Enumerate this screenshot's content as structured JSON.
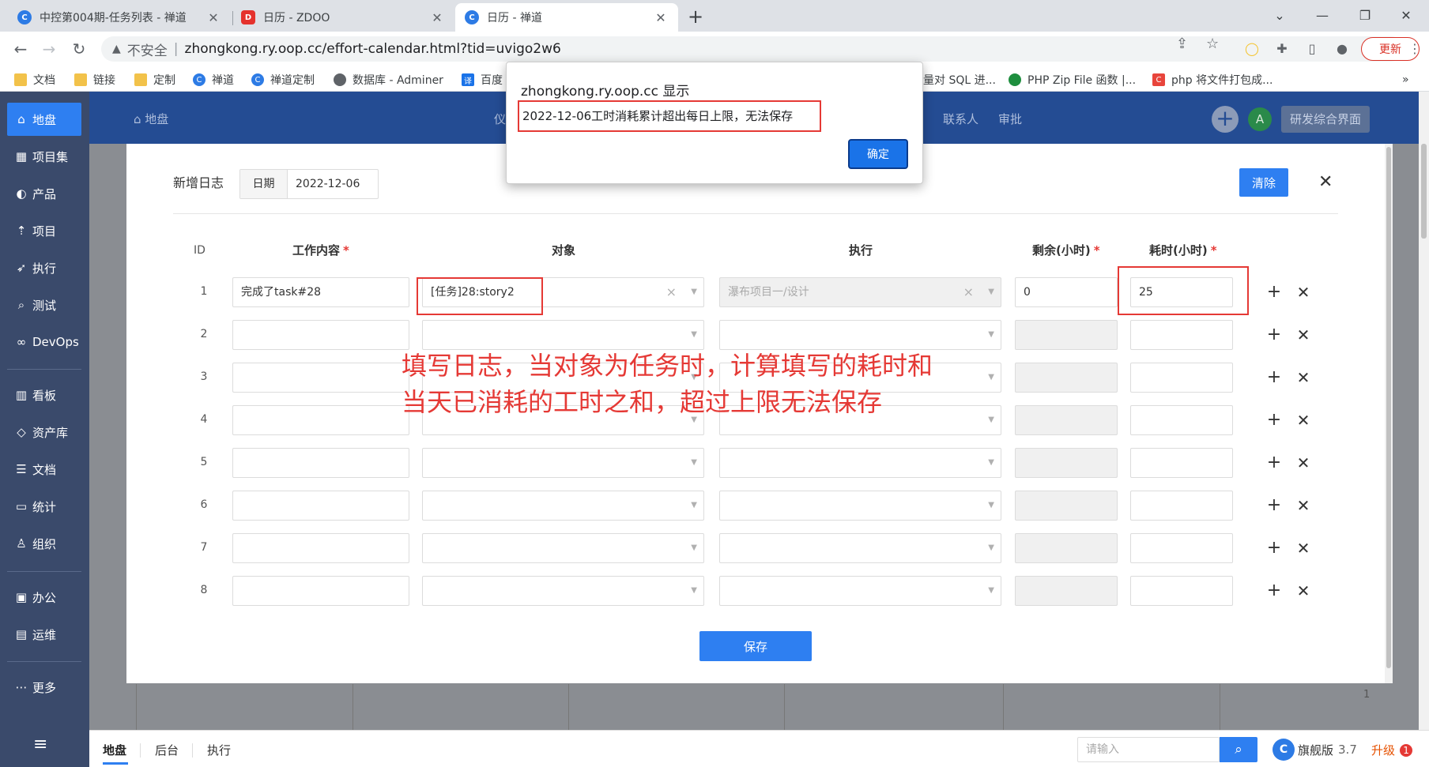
{
  "browser": {
    "tabs": [
      {
        "title": "中控第004期-任务列表 - 禅道",
        "icon": "chandao-icon",
        "active": false
      },
      {
        "title": "日历 - ZDOO",
        "icon": "zdoo-icon",
        "active": false
      },
      {
        "title": "日历 - 禅道",
        "icon": "chandao-icon",
        "active": true
      }
    ],
    "new_tab": "+",
    "insecure_label": "不安全",
    "url": "zhongkong.ry.oop.cc/effort-calendar.html?tid=uvigo2w6",
    "update_label": "更新",
    "bookmarks": [
      {
        "label": "文档",
        "icon": "folder-icon"
      },
      {
        "label": "链接",
        "icon": "folder-icon"
      },
      {
        "label": "定制",
        "icon": "folder-icon"
      },
      {
        "label": "禅道",
        "icon": "chandao-icon"
      },
      {
        "label": "禅道定制",
        "icon": "chandao-icon"
      },
      {
        "label": "数据库 - Adminer",
        "icon": "globe-icon"
      },
      {
        "label": "百度",
        "icon": "translate-icon"
      },
      {
        "label": "量对 SQL 进...",
        "icon": "none"
      },
      {
        "label": "PHP Zip File 函数 |...",
        "icon": "zip-icon"
      },
      {
        "label": "php 将文件打包成...",
        "icon": "php-icon"
      }
    ],
    "bookmarks_more": "»"
  },
  "sidebar": {
    "items": [
      {
        "label": "地盘",
        "icon": "home-icon",
        "glyph": "⌂"
      },
      {
        "label": "项目集",
        "icon": "grid-icon",
        "glyph": "▦"
      },
      {
        "label": "产品",
        "icon": "bulb-icon",
        "glyph": "◐"
      },
      {
        "label": "项目",
        "icon": "rocket-icon",
        "glyph": "⇡"
      },
      {
        "label": "执行",
        "icon": "run-icon",
        "glyph": "➶"
      },
      {
        "label": "测试",
        "icon": "search-icon",
        "glyph": "⌕"
      },
      {
        "label": "DevOps",
        "icon": "infinity-icon",
        "glyph": "∞"
      },
      {
        "label": "看板",
        "icon": "kanban-icon",
        "glyph": "▥"
      },
      {
        "label": "资产库",
        "icon": "diamond-icon",
        "glyph": "◇"
      },
      {
        "label": "文档",
        "icon": "doc-icon",
        "glyph": "☰"
      },
      {
        "label": "统计",
        "icon": "chart-icon",
        "glyph": "▭"
      },
      {
        "label": "组织",
        "icon": "people-icon",
        "glyph": "♙"
      },
      {
        "label": "办公",
        "icon": "office-icon",
        "glyph": "▣"
      },
      {
        "label": "运维",
        "icon": "ops-icon",
        "glyph": "▤"
      },
      {
        "label": "更多",
        "icon": "more-icon",
        "glyph": "⋯"
      }
    ],
    "toggle_glyph": "≡"
  },
  "topnav": {
    "crumb": "地盘",
    "menu_partial": "仪",
    "menu": [
      "联系人",
      "审批"
    ],
    "avatar": "A",
    "switch_label": "研发综合界面"
  },
  "calendar_bg": {
    "day_number": "1"
  },
  "modal": {
    "title": "新增日志",
    "date_label": "日期",
    "date_value": "2022-12-06",
    "clear_label": "清除",
    "close_glyph": "✕",
    "headers": {
      "id": "ID",
      "content": "工作内容",
      "object": "对象",
      "execution": "执行",
      "left": "剩余(小时)",
      "consumed": "耗时(小时)",
      "required_mark": "*"
    },
    "rows": [
      {
        "id": "1",
        "content": "完成了task#28",
        "object": "[任务]28:story2",
        "execution": "瀑布项目一/设计",
        "left": "0",
        "consumed": "25"
      },
      {
        "id": "2",
        "content": "",
        "object": "",
        "execution": "",
        "left": "",
        "consumed": ""
      },
      {
        "id": "3",
        "content": "",
        "object": "",
        "execution": "",
        "left": "",
        "consumed": ""
      },
      {
        "id": "4",
        "content": "",
        "object": "",
        "execution": "",
        "left": "",
        "consumed": ""
      },
      {
        "id": "5",
        "content": "",
        "object": "",
        "execution": "",
        "left": "",
        "consumed": ""
      },
      {
        "id": "6",
        "content": "",
        "object": "",
        "execution": "",
        "left": "",
        "consumed": ""
      },
      {
        "id": "7",
        "content": "",
        "object": "",
        "execution": "",
        "left": "",
        "consumed": ""
      },
      {
        "id": "8",
        "content": "",
        "object": "",
        "execution": "",
        "left": "",
        "consumed": ""
      }
    ],
    "add_glyph": "+",
    "remove_glyph": "✕",
    "save_label": "保存"
  },
  "annotation": {
    "line1": "填写日志，当对象为任务时，计算填写的耗时和",
    "line2": "当天已消耗的工时之和，超过上限无法保存"
  },
  "alert": {
    "title": "zhongkong.ry.oop.cc 显示",
    "message": "2022-12-06工时消耗累计超出每日上限，无法保存",
    "ok_label": "确定"
  },
  "bottombar": {
    "tabs": [
      "地盘",
      "后台",
      "执行"
    ],
    "search_placeholder": "请输入",
    "edition": "旗舰版",
    "version": "3.7",
    "upgrade_label": "升级",
    "upgrade_badge": "1"
  },
  "colors": {
    "accent": "#2e7ff1",
    "sidebar": "#3a4a6b",
    "topnav": "#244c93",
    "highlight": "#e53935"
  }
}
